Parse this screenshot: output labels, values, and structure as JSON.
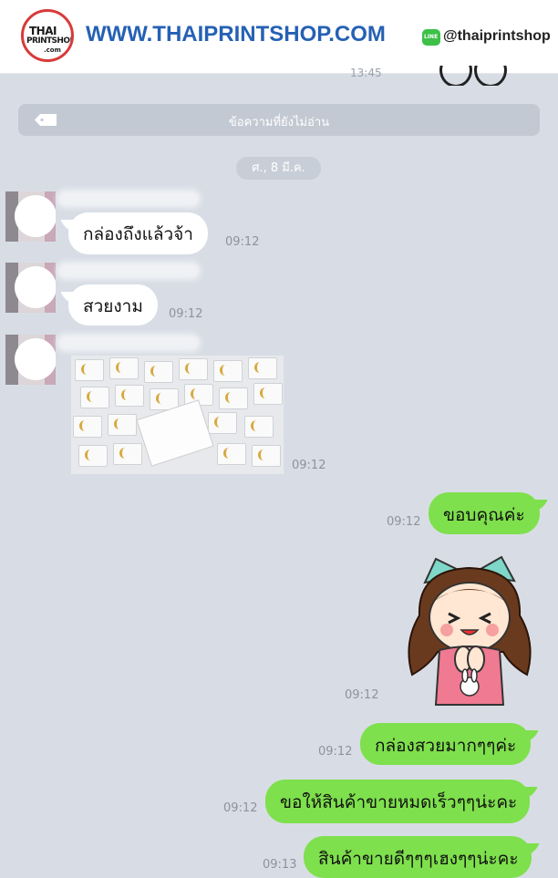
{
  "header": {
    "logo_text_top": "THAI",
    "logo_text_mid": "PRINTSHOP",
    "logo_text_bottom": ".com",
    "site_url": "WWW.THAIPRINTSHOP.COM",
    "line_handle": "@thaiprintshop",
    "line_icon": "line-app-icon"
  },
  "chat": {
    "prev_time": "13:45",
    "unread_banner": "ข้อความที่ยังไม่อ่าน",
    "date_divider": "ศ., 8 มี.ค.",
    "messages": [
      {
        "side": "in",
        "text": "กล่องถึงแล้วจ้า",
        "time": "09:12"
      },
      {
        "side": "in",
        "text": "สวยงาม",
        "time": "09:12"
      },
      {
        "side": "in",
        "type": "photo",
        "time": "09:12"
      },
      {
        "side": "out",
        "text": "ขอบคุณค่ะ",
        "time": "09:12"
      },
      {
        "side": "out",
        "type": "sticker",
        "time": "09:12"
      },
      {
        "side": "out",
        "text": "กล่องสวยมากๆๆค่ะ",
        "time": "09:12"
      },
      {
        "side": "out",
        "text": "ขอให้สินค้าขายหมดเร็วๆๆน่ะคะ",
        "time": "09:12"
      },
      {
        "side": "out",
        "text": "สินค้าขายดีๆๆๆเฮงๆๆน่ะคะ",
        "time": "09:13"
      }
    ]
  },
  "colors": {
    "chat_background": "#d8dde5",
    "outgoing_bubble": "#7ee04c",
    "incoming_bubble": "#ffffff",
    "brand_blue": "#2561b4",
    "line_green": "#3cc048"
  }
}
